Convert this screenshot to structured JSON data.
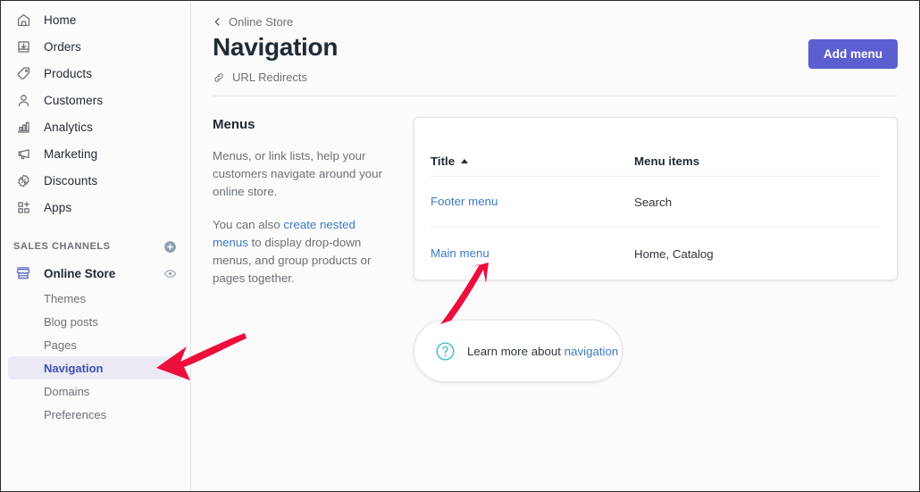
{
  "sidebar": {
    "main_nav": [
      {
        "label": "Home",
        "icon": "home-icon"
      },
      {
        "label": "Orders",
        "icon": "orders-inbox-icon"
      },
      {
        "label": "Products",
        "icon": "tag-icon"
      },
      {
        "label": "Customers",
        "icon": "person-icon"
      },
      {
        "label": "Analytics",
        "icon": "bar-chart-icon"
      },
      {
        "label": "Marketing",
        "icon": "megaphone-icon"
      },
      {
        "label": "Discounts",
        "icon": "percent-badge-icon"
      },
      {
        "label": "Apps",
        "icon": "apps-grid-plus-icon"
      }
    ],
    "sales_channels": {
      "section_label": "SALES CHANNELS",
      "add_icon": "plus-circle-icon",
      "channel": {
        "label": "Online Store",
        "icon": "storefront-icon",
        "view_icon": "eye-icon"
      },
      "sub_items": [
        {
          "label": "Themes",
          "active": false
        },
        {
          "label": "Blog posts",
          "active": false
        },
        {
          "label": "Pages",
          "active": false
        },
        {
          "label": "Navigation",
          "active": true
        },
        {
          "label": "Domains",
          "active": false
        },
        {
          "label": "Preferences",
          "active": false
        }
      ]
    }
  },
  "header": {
    "breadcrumb": "Online Store",
    "breadcrumb_icon": "chevron-left-icon",
    "title": "Navigation",
    "url_redirects": "URL Redirects",
    "url_redirects_icon": "link-chain-icon",
    "add_menu_button": "Add menu"
  },
  "menus_panel": {
    "heading": "Menus",
    "paragraph1": "Menus, or link lists, help your customers navigate around your online store.",
    "paragraph2_prefix": "You can also ",
    "paragraph2_link": "create nested menus",
    "paragraph2_suffix": " to display drop-down menus, and group products or pages together."
  },
  "menus_table": {
    "columns": [
      {
        "label": "Title",
        "sorted": "asc",
        "sort_icon": "caret-up-icon"
      },
      {
        "label": "Menu items",
        "sorted": "none"
      }
    ],
    "rows": [
      {
        "title": "Footer menu",
        "items": "Search"
      },
      {
        "title": "Main menu",
        "items": "Home, Catalog"
      }
    ]
  },
  "learn_more": {
    "icon": "question-circle-icon",
    "prefix": "Learn more about ",
    "link": "navigation"
  },
  "annotations": {
    "arrow_color": "#ed0e3c",
    "arrow_sidebar_target": "Navigation",
    "arrow_table_target": "Main menu"
  },
  "colors": {
    "accent_purple": "#5c5fcf",
    "link_blue": "#3e7ac0",
    "teal": "#47c1bf",
    "active_nav_bg": "#ebeaf4",
    "active_nav_text": "#3f4eae"
  }
}
